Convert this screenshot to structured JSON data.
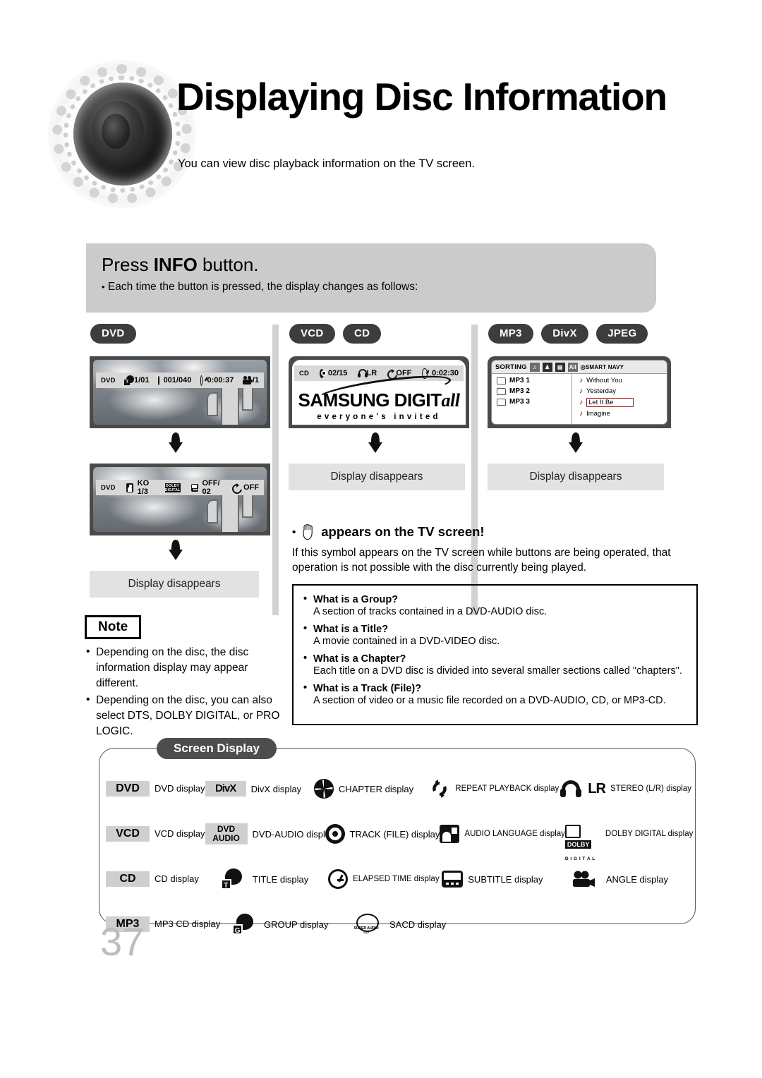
{
  "header": {
    "title": "Displaying Disc Information",
    "subtitle": "You can view disc playback information  on the TV screen."
  },
  "info_banner": {
    "heading_pre": "Press ",
    "heading_key": "INFO",
    "heading_post": " button.",
    "bullet": "Each time the button is pressed, the display changes as follows:"
  },
  "columns": [
    {
      "badges": [
        "DVD"
      ],
      "screen1": {
        "osd": [
          {
            "label": "DVD",
            "icon": "",
            "value": ""
          },
          {
            "label": "",
            "icon": "title-icon",
            "value": "01/01"
          },
          {
            "label": "",
            "icon": "chapter-icon",
            "value": "001/040"
          },
          {
            "label": "",
            "icon": "elapsed-time-icon",
            "value": "0:00:37"
          },
          {
            "label": "",
            "icon": "angle-icon",
            "value": "1/1"
          }
        ]
      },
      "screen2": {
        "osd": [
          {
            "label": "DVD",
            "icon": "",
            "value": ""
          },
          {
            "label": "",
            "icon": "audio-language-icon",
            "value": "KO 1/3"
          },
          {
            "label": "",
            "icon": "dolby-digital-icon",
            "value": ""
          },
          {
            "label": "",
            "icon": "subtitle-icon",
            "value": "OFF/ 02"
          },
          {
            "label": "",
            "icon": "repeat-icon",
            "value": "OFF"
          }
        ]
      },
      "disappears": "Display disappears"
    },
    {
      "badges": [
        "VCD",
        "CD"
      ],
      "screen1": {
        "osd": [
          {
            "label": "CD",
            "icon": "",
            "value": ""
          },
          {
            "label": "",
            "icon": "track-icon",
            "value": "02/15"
          },
          {
            "label": "",
            "icon": "stereo-icon",
            "value": "LR"
          },
          {
            "label": "",
            "icon": "repeat-icon",
            "value": "OFF"
          },
          {
            "label": "",
            "icon": "elapsed-time-icon",
            "value": "0:02:30"
          }
        ],
        "logo_line1_a": "S",
        "logo_line1_b": "AMSUNG DIGIT",
        "logo_line1_c": "all",
        "logo_line2": "everyone's invited",
        "logo_tm": "tm"
      },
      "disappears": "Display disappears"
    },
    {
      "badges": [
        "MP3",
        "DivX",
        "JPEG"
      ],
      "screen1": {
        "sorting_label": "SORTING",
        "smart_navy": "SMART NAVY",
        "sort_icons": [
          "music-sort-icon",
          "artist-sort-icon",
          "video-sort-icon",
          "all-sort-icon"
        ],
        "all_label": "All",
        "folders": [
          "MP3 1",
          "MP3 2",
          "MP3 3"
        ],
        "tracks": [
          "Without You",
          "Yesterday",
          "Let It Be",
          "Imagine"
        ],
        "selected_track": "Let It Be"
      },
      "disappears": "Display disappears"
    }
  ],
  "note": {
    "tag": "Note",
    "items": [
      "Depending on the disc, the disc information display may appear different.",
      "Depending on the disc, you can also select DTS, DOLBY DIGITAL, or PRO LOGIC."
    ]
  },
  "hand_section": {
    "heading": "appears on the TV screen!",
    "body": "If this symbol appears on the TV screen while buttons are being operated, that operation is not possible with the disc currently being played."
  },
  "qa": [
    {
      "q": "What is a Group?",
      "a": "A section of tracks contained in a DVD-AUDIO disc."
    },
    {
      "q": "What is a Title?",
      "a": "A movie contained in a DVD-VIDEO disc."
    },
    {
      "q": "What is a Chapter?",
      "a": "Each title on a DVD disc is divided into several smaller sections called \"chapters\"."
    },
    {
      "q": "What is a Track (File)?",
      "a": "A section of video or a music file recorded on a DVD-AUDIO, CD, or MP3-CD."
    }
  ],
  "screen_display": {
    "tab": "Screen Display",
    "rows": [
      [
        {
          "chip": "DVD",
          "icon": "",
          "label": "DVD display"
        },
        {
          "chip": "DivX",
          "icon": "",
          "label": "DivX display"
        },
        {
          "chip": "",
          "icon": "chapter-icon",
          "label": "CHAPTER display"
        },
        {
          "chip": "",
          "icon": "repeat-playback-icon",
          "label": "REPEAT PLAYBACK display"
        },
        {
          "chip": "",
          "icon": "stereo-icon",
          "label": "STEREO (L/R) display",
          "extra": "LR"
        }
      ],
      [
        {
          "chip": "VCD",
          "icon": "",
          "label": "VCD display"
        },
        {
          "chip": "DVD AUDIO",
          "icon": "",
          "label": "DVD-AUDIO display"
        },
        {
          "chip": "",
          "icon": "track-icon",
          "label": "TRACK (FILE) display"
        },
        {
          "chip": "",
          "icon": "audio-language-icon",
          "label": "AUDIO LANGUAGE display"
        },
        {
          "chip": "",
          "icon": "dolby-digital-icon",
          "label": "DOLBY DIGITAL display"
        }
      ],
      [
        {
          "chip": "CD",
          "icon": "",
          "label": "CD display"
        },
        {
          "chip": "",
          "icon": "title-icon",
          "label": "TITLE display"
        },
        {
          "chip": "",
          "icon": "elapsed-time-icon",
          "label": "ELAPSED TIME display"
        },
        {
          "chip": "",
          "icon": "subtitle-icon",
          "label": "SUBTITLE display"
        },
        {
          "chip": "",
          "icon": "angle-icon",
          "label": "ANGLE display"
        }
      ],
      [
        {
          "chip": "MP3",
          "icon": "",
          "label": "MP3 CD display"
        },
        {
          "chip": "",
          "icon": "group-icon",
          "label": "GROUP display"
        },
        {
          "chip": "",
          "icon": "sacd-icon",
          "label": "SACD display"
        },
        null,
        null
      ]
    ],
    "dolby_top": "DOLBY",
    "dolby_bottom": "D I G I T A L",
    "sacd_caption": "SUPER AUDIO CD",
    "title_letter": "T",
    "group_letter": "G"
  },
  "page_number": "37"
}
